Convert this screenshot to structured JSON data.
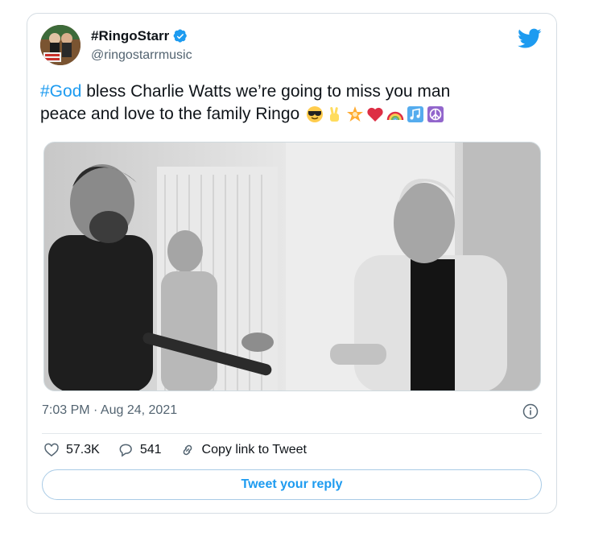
{
  "tweet": {
    "display_name": "#RingoStarr",
    "handle": "@ringostarrmusic",
    "text_hashtag": "#God",
    "text_line1_rest": " bless Charlie Watts we’re going to miss you man",
    "text_line2": "peace and love to the family Ringo",
    "emojis": [
      "😎",
      "✌️",
      "🌟",
      "❤️",
      "🌈",
      "🎶",
      "☮️"
    ],
    "timestamp": "7:03 PM · Aug 24, 2021",
    "likes": "57.3K",
    "replies": "541",
    "copy_link_label": "Copy link to Tweet",
    "reply_button_label": "Tweet your reply"
  },
  "colors": {
    "accent": "#1d9bf0",
    "text": "#0f1419",
    "secondary": "#536471",
    "border": "#cfd9de"
  },
  "icons": [
    "verified-badge-icon",
    "twitter-bird-icon",
    "info-icon",
    "heart-icon",
    "reply-bubble-icon",
    "link-icon"
  ]
}
